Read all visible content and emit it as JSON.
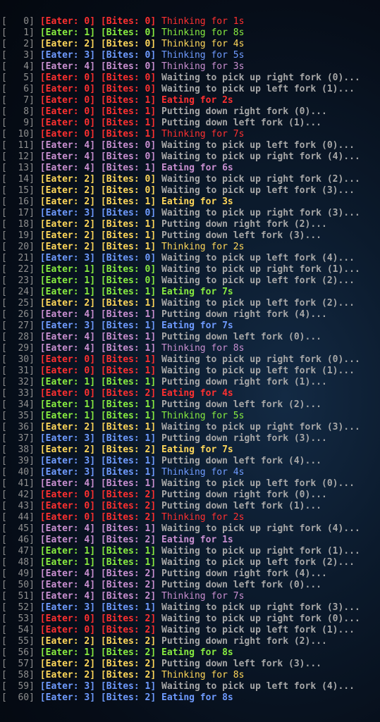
{
  "colors": {
    "index": "#8f8f8f",
    "waiting": "#a7a7a7",
    "eater": {
      "0": "#ff3030",
      "1": "#88ec40",
      "2": "#ffd75a",
      "3": "#6f9bff",
      "4": "#c98fd0"
    }
  },
  "lines": [
    {
      "idx": "[   0]",
      "eater": "0",
      "eater_text": "[Eater: 0]",
      "bites_text": "[Bites: 0]",
      "msg": "Thinking for 1s",
      "style": "normal"
    },
    {
      "idx": "[   1]",
      "eater": "1",
      "eater_text": "[Eater: 1]",
      "bites_text": "[Bites: 0]",
      "msg": "Thinking for 8s",
      "style": "normal"
    },
    {
      "idx": "[   2]",
      "eater": "2",
      "eater_text": "[Eater: 2]",
      "bites_text": "[Bites: 0]",
      "msg": "Thinking for 4s",
      "style": "normal"
    },
    {
      "idx": "[   3]",
      "eater": "3",
      "eater_text": "[Eater: 3]",
      "bites_text": "[Bites: 0]",
      "msg": "Thinking for 5s",
      "style": "normal"
    },
    {
      "idx": "[   4]",
      "eater": "4",
      "eater_text": "[Eater: 4]",
      "bites_text": "[Bites: 0]",
      "msg": "Thinking for 3s",
      "style": "normal"
    },
    {
      "idx": "[   5]",
      "eater": "0",
      "eater_text": "[Eater: 0]",
      "bites_text": "[Bites: 0]",
      "msg": "Waiting to pick up right fork (0)...",
      "style": "gray"
    },
    {
      "idx": "[   6]",
      "eater": "0",
      "eater_text": "[Eater: 0]",
      "bites_text": "[Bites: 0]",
      "msg": "Waiting to pick up left fork (1)...",
      "style": "gray"
    },
    {
      "idx": "[   7]",
      "eater": "0",
      "eater_text": "[Eater: 0]",
      "bites_text": "[Bites: 1]",
      "msg": "Eating for 2s",
      "style": "bold"
    },
    {
      "idx": "[   8]",
      "eater": "0",
      "eater_text": "[Eater: 0]",
      "bites_text": "[Bites: 1]",
      "msg": "Putting down right fork (0)...",
      "style": "gray"
    },
    {
      "idx": "[   9]",
      "eater": "0",
      "eater_text": "[Eater: 0]",
      "bites_text": "[Bites: 1]",
      "msg": "Putting down left fork (1)...",
      "style": "gray"
    },
    {
      "idx": "[  10]",
      "eater": "0",
      "eater_text": "[Eater: 0]",
      "bites_text": "[Bites: 1]",
      "msg": "Thinking for 7s",
      "style": "normal"
    },
    {
      "idx": "[  11]",
      "eater": "4",
      "eater_text": "[Eater: 4]",
      "bites_text": "[Bites: 0]",
      "msg": "Waiting to pick up left fork (0)...",
      "style": "gray"
    },
    {
      "idx": "[  12]",
      "eater": "4",
      "eater_text": "[Eater: 4]",
      "bites_text": "[Bites: 0]",
      "msg": "Waiting to pick up right fork (4)...",
      "style": "gray"
    },
    {
      "idx": "[  13]",
      "eater": "4",
      "eater_text": "[Eater: 4]",
      "bites_text": "[Bites: 1]",
      "msg": "Eating for 6s",
      "style": "bold"
    },
    {
      "idx": "[  14]",
      "eater": "2",
      "eater_text": "[Eater: 2]",
      "bites_text": "[Bites: 0]",
      "msg": "Waiting to pick up right fork (2)...",
      "style": "gray"
    },
    {
      "idx": "[  15]",
      "eater": "2",
      "eater_text": "[Eater: 2]",
      "bites_text": "[Bites: 0]",
      "msg": "Waiting to pick up left fork (3)...",
      "style": "gray"
    },
    {
      "idx": "[  16]",
      "eater": "2",
      "eater_text": "[Eater: 2]",
      "bites_text": "[Bites: 1]",
      "msg": "Eating for 3s",
      "style": "bold"
    },
    {
      "idx": "[  17]",
      "eater": "3",
      "eater_text": "[Eater: 3]",
      "bites_text": "[Bites: 0]",
      "msg": "Waiting to pick up right fork (3)...",
      "style": "gray"
    },
    {
      "idx": "[  18]",
      "eater": "2",
      "eater_text": "[Eater: 2]",
      "bites_text": "[Bites: 1]",
      "msg": "Putting down right fork (2)...",
      "style": "gray"
    },
    {
      "idx": "[  19]",
      "eater": "2",
      "eater_text": "[Eater: 2]",
      "bites_text": "[Bites: 1]",
      "msg": "Putting down left fork (3)...",
      "style": "gray"
    },
    {
      "idx": "[  20]",
      "eater": "2",
      "eater_text": "[Eater: 2]",
      "bites_text": "[Bites: 1]",
      "msg": "Thinking for 2s",
      "style": "normal"
    },
    {
      "idx": "[  21]",
      "eater": "3",
      "eater_text": "[Eater: 3]",
      "bites_text": "[Bites: 0]",
      "msg": "Waiting to pick up left fork (4)...",
      "style": "gray"
    },
    {
      "idx": "[  22]",
      "eater": "1",
      "eater_text": "[Eater: 1]",
      "bites_text": "[Bites: 0]",
      "msg": "Waiting to pick up right fork (1)...",
      "style": "gray"
    },
    {
      "idx": "[  23]",
      "eater": "1",
      "eater_text": "[Eater: 1]",
      "bites_text": "[Bites: 0]",
      "msg": "Waiting to pick up left fork (2)...",
      "style": "gray"
    },
    {
      "idx": "[  24]",
      "eater": "1",
      "eater_text": "[Eater: 1]",
      "bites_text": "[Bites: 1]",
      "msg": "Eating for 7s",
      "style": "bold"
    },
    {
      "idx": "[  25]",
      "eater": "2",
      "eater_text": "[Eater: 2]",
      "bites_text": "[Bites: 1]",
      "msg": "Waiting to pick up left fork (2)...",
      "style": "gray"
    },
    {
      "idx": "[  26]",
      "eater": "4",
      "eater_text": "[Eater: 4]",
      "bites_text": "[Bites: 1]",
      "msg": "Putting down right fork (4)...",
      "style": "gray"
    },
    {
      "idx": "[  27]",
      "eater": "3",
      "eater_text": "[Eater: 3]",
      "bites_text": "[Bites: 1]",
      "msg": "Eating for 7s",
      "style": "bold"
    },
    {
      "idx": "[  28]",
      "eater": "4",
      "eater_text": "[Eater: 4]",
      "bites_text": "[Bites: 1]",
      "msg": "Putting down left fork (0)...",
      "style": "gray"
    },
    {
      "idx": "[  29]",
      "eater": "4",
      "eater_text": "[Eater: 4]",
      "bites_text": "[Bites: 1]",
      "msg": "Thinking for 8s",
      "style": "normal"
    },
    {
      "idx": "[  30]",
      "eater": "0",
      "eater_text": "[Eater: 0]",
      "bites_text": "[Bites: 1]",
      "msg": "Waiting to pick up right fork (0)...",
      "style": "gray"
    },
    {
      "idx": "[  31]",
      "eater": "0",
      "eater_text": "[Eater: 0]",
      "bites_text": "[Bites: 1]",
      "msg": "Waiting to pick up left fork (1)...",
      "style": "gray"
    },
    {
      "idx": "[  32]",
      "eater": "1",
      "eater_text": "[Eater: 1]",
      "bites_text": "[Bites: 1]",
      "msg": "Putting down right fork (1)...",
      "style": "gray"
    },
    {
      "idx": "[  33]",
      "eater": "0",
      "eater_text": "[Eater: 0]",
      "bites_text": "[Bites: 2]",
      "msg": "Eating for 4s",
      "style": "bold"
    },
    {
      "idx": "[  34]",
      "eater": "1",
      "eater_text": "[Eater: 1]",
      "bites_text": "[Bites: 1]",
      "msg": "Putting down left fork (2)...",
      "style": "gray"
    },
    {
      "idx": "[  35]",
      "eater": "1",
      "eater_text": "[Eater: 1]",
      "bites_text": "[Bites: 1]",
      "msg": "Thinking for 5s",
      "style": "normal"
    },
    {
      "idx": "[  36]",
      "eater": "2",
      "eater_text": "[Eater: 2]",
      "bites_text": "[Bites: 1]",
      "msg": "Waiting to pick up right fork (3)...",
      "style": "gray"
    },
    {
      "idx": "[  37]",
      "eater": "3",
      "eater_text": "[Eater: 3]",
      "bites_text": "[Bites: 1]",
      "msg": "Putting down right fork (3)...",
      "style": "gray"
    },
    {
      "idx": "[  38]",
      "eater": "2",
      "eater_text": "[Eater: 2]",
      "bites_text": "[Bites: 2]",
      "msg": "Eating for 7s",
      "style": "bold"
    },
    {
      "idx": "[  39]",
      "eater": "3",
      "eater_text": "[Eater: 3]",
      "bites_text": "[Bites: 1]",
      "msg": "Putting down left fork (4)...",
      "style": "gray"
    },
    {
      "idx": "[  40]",
      "eater": "3",
      "eater_text": "[Eater: 3]",
      "bites_text": "[Bites: 1]",
      "msg": "Thinking for 4s",
      "style": "normal"
    },
    {
      "idx": "[  41]",
      "eater": "4",
      "eater_text": "[Eater: 4]",
      "bites_text": "[Bites: 1]",
      "msg": "Waiting to pick up left fork (0)...",
      "style": "gray"
    },
    {
      "idx": "[  42]",
      "eater": "0",
      "eater_text": "[Eater: 0]",
      "bites_text": "[Bites: 2]",
      "msg": "Putting down right fork (0)...",
      "style": "gray"
    },
    {
      "idx": "[  43]",
      "eater": "0",
      "eater_text": "[Eater: 0]",
      "bites_text": "[Bites: 2]",
      "msg": "Putting down left fork (1)...",
      "style": "gray"
    },
    {
      "idx": "[  44]",
      "eater": "0",
      "eater_text": "[Eater: 0]",
      "bites_text": "[Bites: 2]",
      "msg": "Thinking for 2s",
      "style": "normal"
    },
    {
      "idx": "[  45]",
      "eater": "4",
      "eater_text": "[Eater: 4]",
      "bites_text": "[Bites: 1]",
      "msg": "Waiting to pick up right fork (4)...",
      "style": "gray"
    },
    {
      "idx": "[  46]",
      "eater": "4",
      "eater_text": "[Eater: 4]",
      "bites_text": "[Bites: 2]",
      "msg": "Eating for 1s",
      "style": "bold"
    },
    {
      "idx": "[  47]",
      "eater": "1",
      "eater_text": "[Eater: 1]",
      "bites_text": "[Bites: 1]",
      "msg": "Waiting to pick up right fork (1)...",
      "style": "gray"
    },
    {
      "idx": "[  48]",
      "eater": "1",
      "eater_text": "[Eater: 1]",
      "bites_text": "[Bites: 1]",
      "msg": "Waiting to pick up left fork (2)...",
      "style": "gray"
    },
    {
      "idx": "[  49]",
      "eater": "4",
      "eater_text": "[Eater: 4]",
      "bites_text": "[Bites: 2]",
      "msg": "Putting down right fork (4)...",
      "style": "gray"
    },
    {
      "idx": "[  50]",
      "eater": "4",
      "eater_text": "[Eater: 4]",
      "bites_text": "[Bites: 2]",
      "msg": "Putting down left fork (0)...",
      "style": "gray"
    },
    {
      "idx": "[  51]",
      "eater": "4",
      "eater_text": "[Eater: 4]",
      "bites_text": "[Bites: 2]",
      "msg": "Thinking for 7s",
      "style": "normal"
    },
    {
      "idx": "[  52]",
      "eater": "3",
      "eater_text": "[Eater: 3]",
      "bites_text": "[Bites: 1]",
      "msg": "Waiting to pick up right fork (3)...",
      "style": "gray"
    },
    {
      "idx": "[  53]",
      "eater": "0",
      "eater_text": "[Eater: 0]",
      "bites_text": "[Bites: 2]",
      "msg": "Waiting to pick up right fork (0)...",
      "style": "gray"
    },
    {
      "idx": "[  54]",
      "eater": "0",
      "eater_text": "[Eater: 0]",
      "bites_text": "[Bites: 2]",
      "msg": "Waiting to pick up left fork (1)...",
      "style": "gray"
    },
    {
      "idx": "[  55]",
      "eater": "2",
      "eater_text": "[Eater: 2]",
      "bites_text": "[Bites: 2]",
      "msg": "Putting down right fork (2)...",
      "style": "gray"
    },
    {
      "idx": "[  56]",
      "eater": "1",
      "eater_text": "[Eater: 1]",
      "bites_text": "[Bites: 2]",
      "msg": "Eating for 8s",
      "style": "bold"
    },
    {
      "idx": "[  57]",
      "eater": "2",
      "eater_text": "[Eater: 2]",
      "bites_text": "[Bites: 2]",
      "msg": "Putting down left fork (3)...",
      "style": "gray"
    },
    {
      "idx": "[  58]",
      "eater": "2",
      "eater_text": "[Eater: 2]",
      "bites_text": "[Bites: 2]",
      "msg": "Thinking for 8s",
      "style": "normal"
    },
    {
      "idx": "[  59]",
      "eater": "3",
      "eater_text": "[Eater: 3]",
      "bites_text": "[Bites: 1]",
      "msg": "Waiting to pick up left fork (4)...",
      "style": "gray"
    },
    {
      "idx": "[  60]",
      "eater": "3",
      "eater_text": "[Eater: 3]",
      "bites_text": "[Bites: 2]",
      "msg": "Eating for 8s",
      "style": "bold"
    }
  ]
}
